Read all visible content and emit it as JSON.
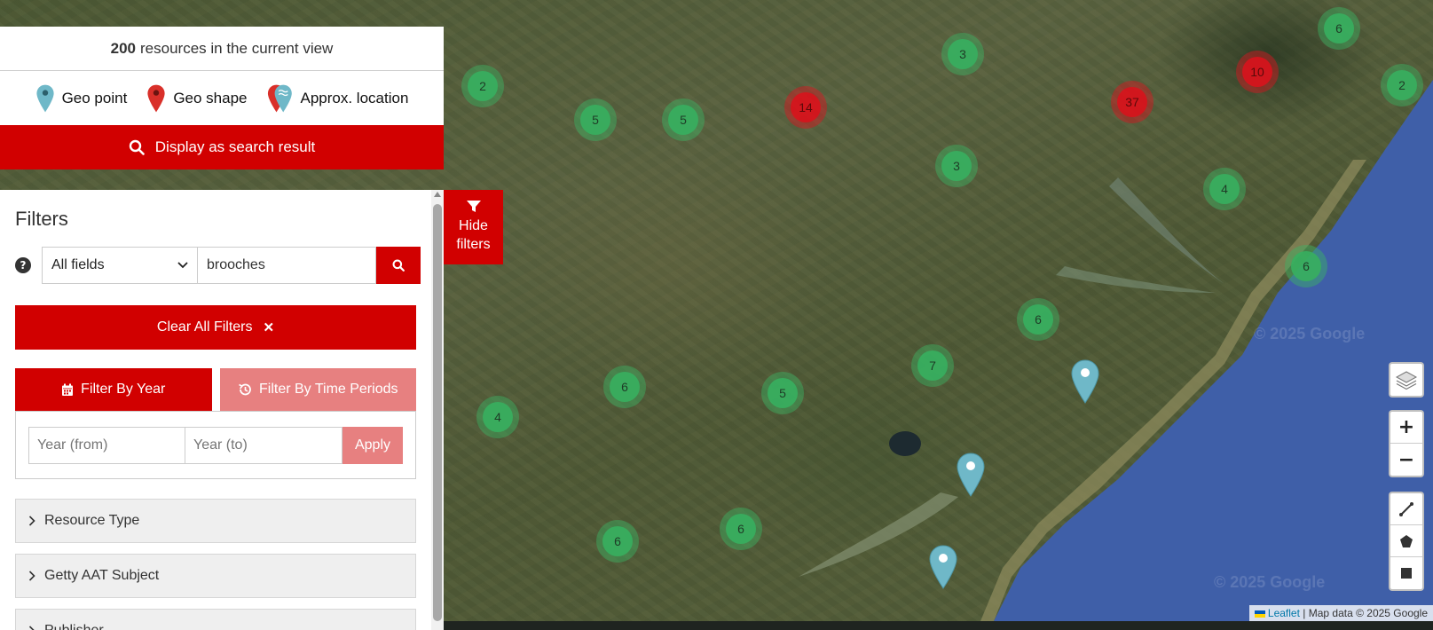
{
  "results": {
    "count": "200",
    "text": "resources in the current view"
  },
  "legend": {
    "geo_point": "Geo point",
    "geo_shape": "Geo shape",
    "approx_location": "Approx. location"
  },
  "display_button": "Display as search result",
  "hide_filters": {
    "line1": "Hide",
    "line2": "filters"
  },
  "filters": {
    "title": "Filters",
    "field_select": "All fields",
    "search_value": "brooches",
    "clear_all": "Clear All Filters",
    "tab_year": "Filter By Year",
    "tab_periods": "Filter By Time Periods",
    "year_from_placeholder": "Year (from)",
    "year_to_placeholder": "Year (to)",
    "apply": "Apply",
    "accordions": [
      "Resource Type",
      "Getty AAT Subject",
      "Publisher"
    ]
  },
  "clusters": [
    {
      "count": "2",
      "color": "green"
    },
    {
      "count": "5",
      "color": "green"
    },
    {
      "count": "5",
      "color": "green"
    },
    {
      "count": "14",
      "color": "red"
    },
    {
      "count": "3",
      "color": "green"
    },
    {
      "count": "3",
      "color": "green"
    },
    {
      "count": "37",
      "color": "red"
    },
    {
      "count": "10",
      "color": "red"
    },
    {
      "count": "6",
      "color": "green"
    },
    {
      "count": "2",
      "color": "green"
    },
    {
      "count": "4",
      "color": "green"
    },
    {
      "count": "6",
      "color": "green"
    },
    {
      "count": "6",
      "color": "green"
    },
    {
      "count": "7",
      "color": "green"
    },
    {
      "count": "6",
      "color": "green"
    },
    {
      "count": "5",
      "color": "green"
    },
    {
      "count": "4",
      "color": "green"
    },
    {
      "count": "6",
      "color": "green"
    },
    {
      "count": "6",
      "color": "green"
    }
  ],
  "map_controls": {
    "zoom_in": "+",
    "zoom_out": "−"
  },
  "attribution": {
    "leaflet": "Leaflet",
    "rest": "| Map data © 2025 Google"
  },
  "watermark": "© 2025 Google",
  "colors": {
    "brand_red": "#d10000",
    "brand_red_light": "#e78080",
    "cluster_green": "#37af5f",
    "pin_teal": "#6fb8c8"
  }
}
